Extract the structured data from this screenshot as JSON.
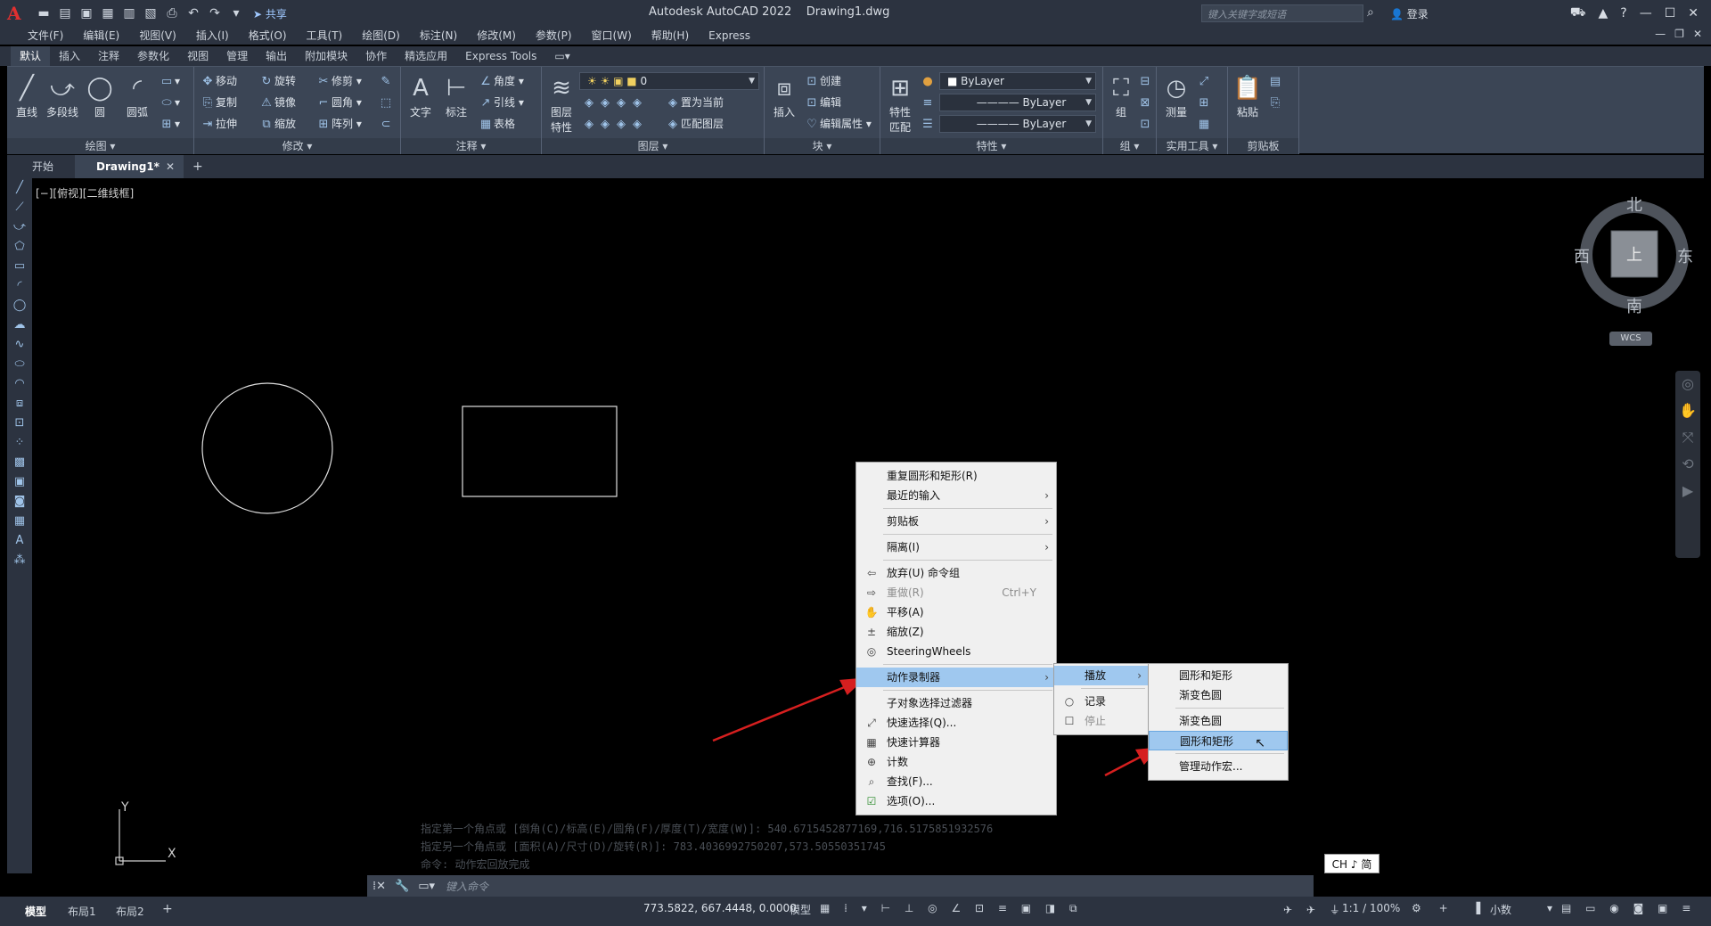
{
  "app": {
    "title": "Autodesk AutoCAD 2022    Drawing1.dwg",
    "share_label": "共享",
    "search_placeholder": "键入关键字或短语",
    "login_label": "登录"
  },
  "menubar": [
    "文件(F)",
    "编辑(E)",
    "视图(V)",
    "插入(I)",
    "格式(O)",
    "工具(T)",
    "绘图(D)",
    "标注(N)",
    "修改(M)",
    "参数(P)",
    "窗口(W)",
    "帮助(H)",
    "Express"
  ],
  "ribbon_tabs": [
    "默认",
    "插入",
    "注释",
    "参数化",
    "视图",
    "管理",
    "输出",
    "附加模块",
    "协作",
    "精选应用",
    "Express Tools"
  ],
  "ribbon": {
    "draw": {
      "title": "绘图",
      "line": "直线",
      "polyline": "多段线",
      "circle": "圆",
      "arc": "圆弧"
    },
    "modify": {
      "title": "修改",
      "move": "移动",
      "rotate": "旋转",
      "trim": "修剪",
      "copy": "复制",
      "mirror": "镜像",
      "fillet": "圆角",
      "stretch": "拉伸",
      "scale": "缩放",
      "array": "阵列"
    },
    "annotation": {
      "title": "注释",
      "text": "文字",
      "dimension": "标注",
      "angle": "角度",
      "leader": "引线",
      "table": "表格"
    },
    "layers": {
      "title": "图层",
      "props": "图层\n特性",
      "props_1": "图层",
      "props_2": "特性",
      "current_layer": "0",
      "set_current": "置为当前",
      "match_layer": "匹配图层"
    },
    "block": {
      "title": "块",
      "insert": "插入",
      "create": "创建",
      "edit": "编辑",
      "edit_attr": "编辑属性"
    },
    "properties": {
      "title": "特性",
      "match_1": "特性",
      "match_2": "匹配",
      "color": "ByLayer",
      "linetype": "ByLayer",
      "lineweight": "ByLayer"
    },
    "groups": {
      "title": "组",
      "group": "组"
    },
    "utilities": {
      "title": "实用工具",
      "measure": "测量"
    },
    "clipboard": {
      "title": "剪贴板",
      "paste": "粘贴"
    }
  },
  "doc_tabs": {
    "start": "开始",
    "drawing": "Drawing1*"
  },
  "viewport_label": "[−][俯视][二维线框]",
  "viewcube": {
    "north": "北",
    "south": "南",
    "east": "东",
    "west": "西",
    "top": "上",
    "wcs": "WCS"
  },
  "ucs": {
    "x": "X",
    "y": "Y"
  },
  "context_menu": {
    "items": [
      {
        "label": "重复圆形和矩形(R)"
      },
      {
        "label": "最近的输入",
        "submenu": true
      },
      {
        "label": "剪贴板",
        "submenu": true
      },
      {
        "label": "隔离(I)",
        "submenu": true
      },
      {
        "label": "放弃(U) 命令组"
      },
      {
        "label": "重做(R)",
        "shortcut": "Ctrl+Y"
      },
      {
        "label": "平移(A)"
      },
      {
        "label": "缩放(Z)"
      },
      {
        "label": "SteeringWheels"
      },
      {
        "label": "动作录制器",
        "submenu": true
      },
      {
        "label": "子对象选择过滤器"
      },
      {
        "label": "快速选择(Q)..."
      },
      {
        "label": "快速计算器"
      },
      {
        "label": "计数"
      },
      {
        "label": "查找(F)..."
      },
      {
        "label": "选项(O)..."
      }
    ]
  },
  "submenu_recorder": {
    "play": "播放",
    "record": "记录",
    "stop": "停止"
  },
  "submenu_play": {
    "items": [
      "圆形和矩形",
      "渐变色圆",
      "渐变色圆",
      "圆形和矩形",
      "管理动作宏..."
    ]
  },
  "command_history": [
    "指定第一个角点或 [倒角(C)/标高(E)/圆角(F)/厚度(T)/宽度(W)]: 540.6715452877169,716.5175851932576",
    "指定另一个角点或 [面积(A)/尺寸(D)/旋转(R)]: 783.4036992750207,573.50550351745",
    "命令: 动作宏回放完成"
  ],
  "command_line": {
    "placeholder": "键入命令"
  },
  "ime": "CH ♪ 简",
  "status": {
    "layout_tabs": [
      "模型",
      "布局1",
      "布局2"
    ],
    "coords": "773.5822, 667.4448, 0.0000",
    "model": "模型",
    "scale": "1:1 / 100%",
    "units": "小数"
  },
  "colors": {
    "menu_highlight": "#9fc8ef",
    "arrow": "#d61f1f",
    "background": "#000000",
    "ribbon": "#3b4555"
  }
}
